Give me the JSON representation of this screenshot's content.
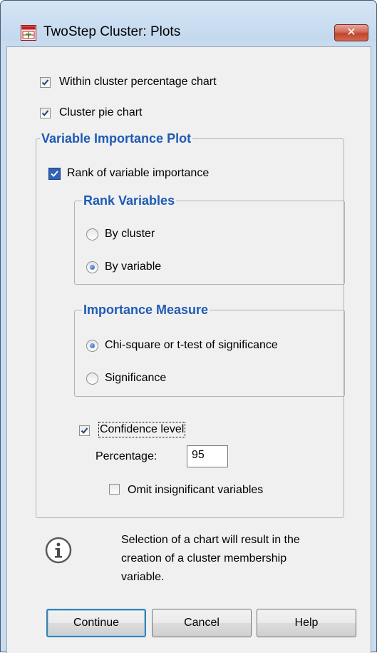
{
  "window": {
    "title": "TwoStep Cluster: Plots",
    "close_glyph": "✕"
  },
  "options": {
    "within_cluster": {
      "label": "Within cluster percentage chart",
      "checked": true
    },
    "cluster_pie": {
      "label": "Cluster pie chart",
      "checked": true
    }
  },
  "variable_importance": {
    "title": "Variable Importance Plot",
    "rank_checkbox": {
      "label": "Rank of variable importance",
      "checked": true
    },
    "rank_variables": {
      "title": "Rank Variables",
      "options": [
        {
          "label": "By cluster",
          "selected": false
        },
        {
          "label": "By variable",
          "selected": true
        }
      ]
    },
    "importance_measure": {
      "title": "Importance Measure",
      "options": [
        {
          "label": "Chi-square or t-test of significance",
          "selected": true
        },
        {
          "label": "Significance",
          "selected": false
        }
      ]
    },
    "confidence": {
      "label": "Confidence level",
      "checked": true
    },
    "percentage": {
      "label": "Percentage:",
      "value": "95"
    },
    "omit": {
      "label": "Omit insignificant variables",
      "checked": false
    }
  },
  "info": {
    "icon": "info-icon",
    "text": [
      "Selection of a chart will result in the",
      "creation of a cluster membership",
      "variable."
    ]
  },
  "buttons": {
    "continue": "Continue",
    "cancel": "Cancel",
    "help": "Help"
  },
  "colors": {
    "group_title": "#1e5bb5",
    "titlebar": "#c9dcef",
    "close": "#c0442e"
  }
}
